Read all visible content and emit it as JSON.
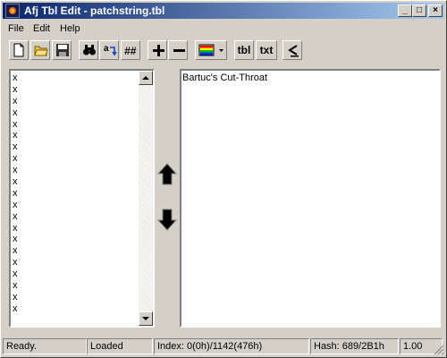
{
  "window": {
    "title": "Afj Tbl Edit - patchstring.tbl"
  },
  "title_buttons": {
    "minimize": "_",
    "maximize": "□",
    "close": "×"
  },
  "menu": [
    {
      "label": "File"
    },
    {
      "label": "Edit"
    },
    {
      "label": "Help"
    }
  ],
  "toolbar": {
    "tbl_label": "tbl",
    "txt_label": "txt"
  },
  "left_list": [
    "x",
    "x",
    "x",
    "x",
    "x",
    "x",
    "x",
    "x",
    "x",
    "x",
    "x",
    "x",
    "x",
    "x",
    "x",
    "x",
    "x",
    "x",
    "x",
    "x",
    "x"
  ],
  "right_text": "Bartuc's Cut-Throat",
  "status": {
    "ready": "Ready.",
    "loaded": "Loaded",
    "index": "Index: 0(0h)/1142(476h)",
    "hash": "Hash: 689/2B1h",
    "version": "1.00"
  }
}
